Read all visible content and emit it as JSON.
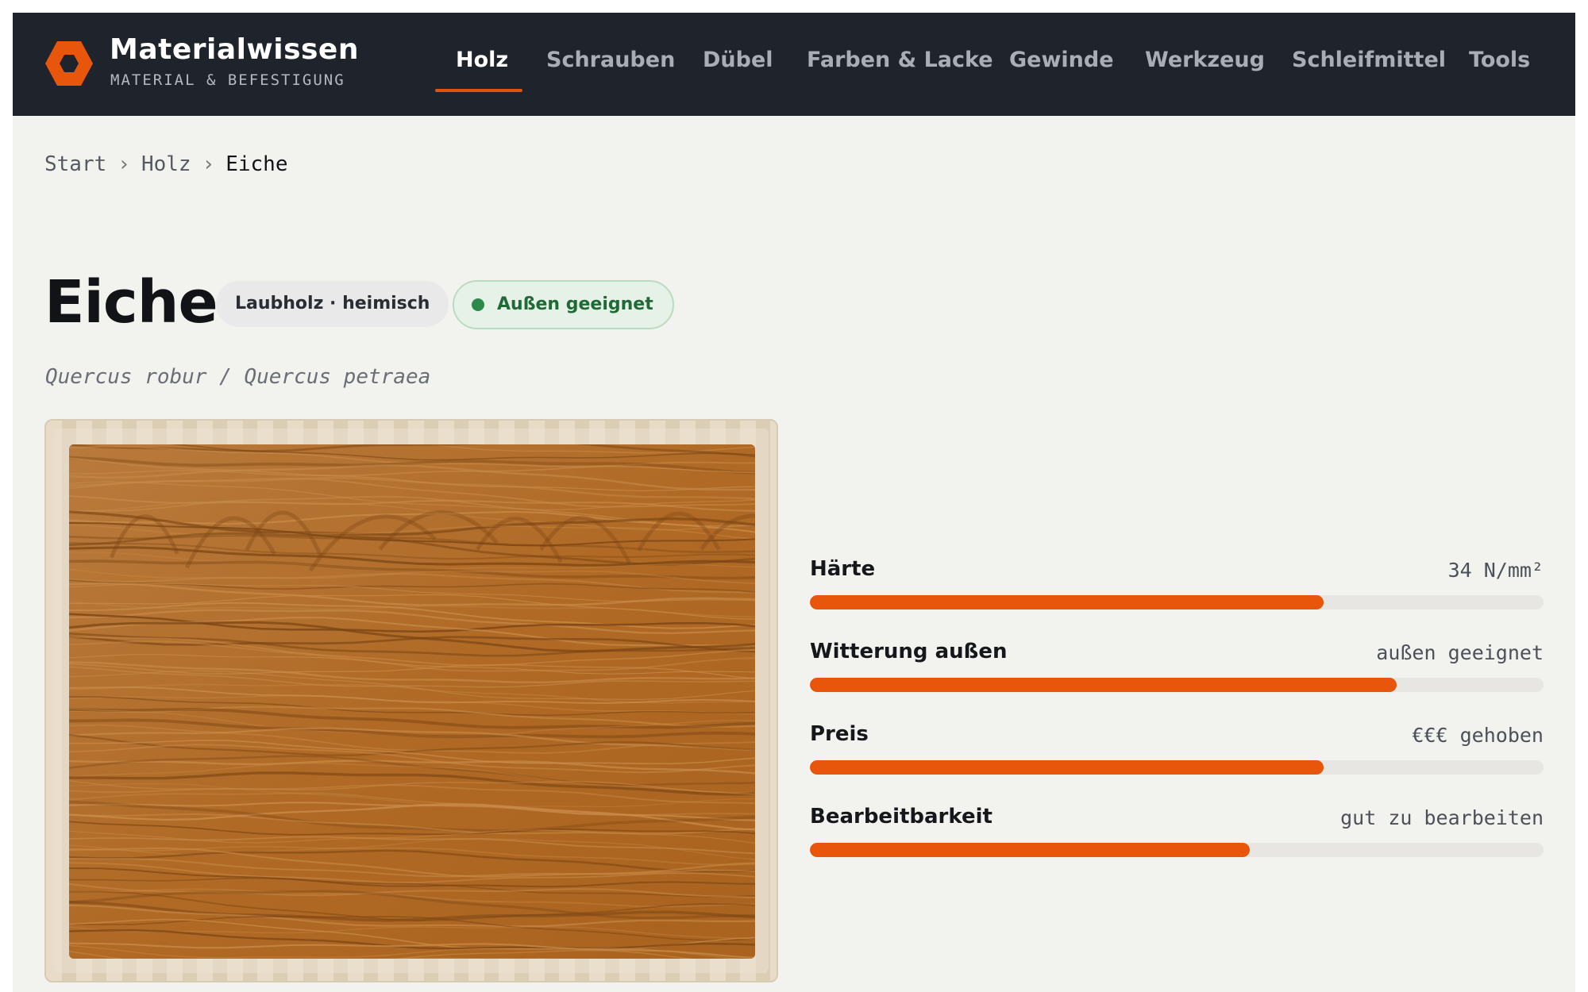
{
  "brand": {
    "name": "Materialwissen",
    "tagline": "MATERIAL & BEFESTIGUNG",
    "accent_color": "#e8560c",
    "logo_icon": "hex-nut-icon"
  },
  "nav": {
    "items": [
      {
        "label": "Holz",
        "active": true
      },
      {
        "label": "Schrauben",
        "active": false
      },
      {
        "label": "Dübel",
        "active": false
      },
      {
        "label": "Farben & Lacke",
        "active": false
      },
      {
        "label": "Gewinde",
        "active": false
      },
      {
        "label": "Werkzeug",
        "active": false
      },
      {
        "label": "Schleifmittel",
        "active": false
      },
      {
        "label": "Tools",
        "active": false
      }
    ]
  },
  "breadcrumb": {
    "items": [
      "Start",
      "Holz"
    ],
    "current": "Eiche",
    "separator": "›"
  },
  "material": {
    "title": "Eiche",
    "category_tag": "Laubholz · heimisch",
    "status_tag": "Außen geeignet",
    "status_color": "#2c8a4a",
    "latin_name": "Quercus robur / Quercus petraea"
  },
  "image": {
    "icon": "oak-wood-grain-sample"
  },
  "properties": [
    {
      "label": "Härte",
      "value": "34 N/mm²",
      "level": 0.7
    },
    {
      "label": "Witterung außen",
      "value": "außen geeignet",
      "level": 0.8
    },
    {
      "label": "Preis",
      "value": "€€€ gehoben",
      "level": 0.7
    },
    {
      "label": "Bearbeitbarkeit",
      "value": "gut zu bearbeiten",
      "level": 0.6
    }
  ]
}
